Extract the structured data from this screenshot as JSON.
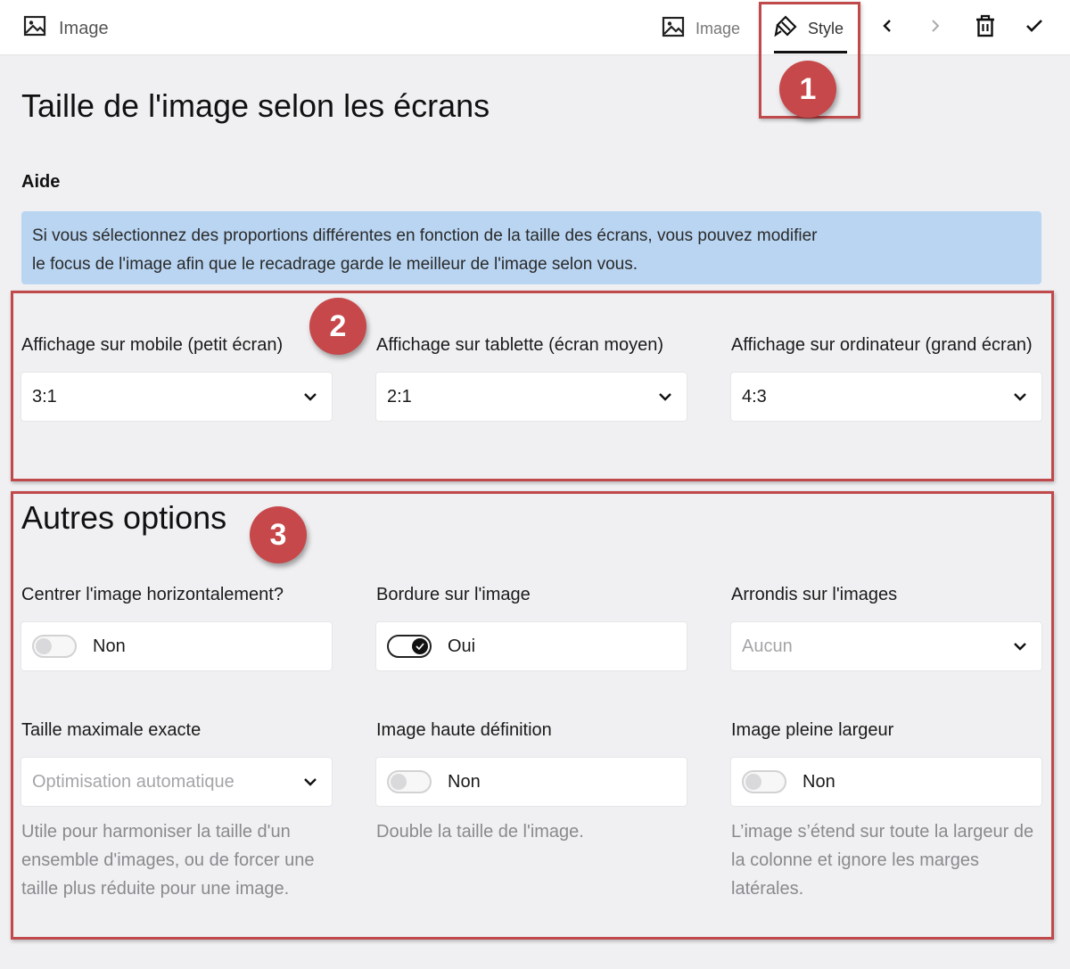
{
  "topbar": {
    "title": "Image",
    "tabs": [
      {
        "label": "Image",
        "icon": "image-icon"
      },
      {
        "label": "Style",
        "icon": "brush-icon",
        "active": true
      }
    ],
    "actions": [
      "chevron-left-icon",
      "chevron-right-icon",
      "trash-icon",
      "check-icon"
    ]
  },
  "page_title": "Taille de l'image selon les écrans",
  "help": {
    "label": "Aide",
    "line1": "Si vous sélectionnez des proportions différentes en fonction de la taille des écrans, vous pouvez modifier",
    "line2": "le focus de l'image afin que le recadrage garde le meilleur de l'image selon vous.",
    "bg_color": "#b9d5f2"
  },
  "ratios": {
    "mobile": {
      "label": "Affichage sur mobile (petit écran)",
      "value": "3:1"
    },
    "tablet": {
      "label": "Affichage sur tablette (écran moyen)",
      "value": "2:1"
    },
    "desktop": {
      "label": "Affichage sur ordinateur (grand écran)",
      "value": "4:3"
    }
  },
  "other": {
    "title": "Autres options",
    "center": {
      "label": "Centrer l'image horizontalement?",
      "value": "Non",
      "on": false
    },
    "border": {
      "label": "Bordure sur l'image",
      "value": "Oui",
      "on": true
    },
    "radius": {
      "label": "Arrondis sur l'images",
      "placeholder": "Aucun"
    },
    "max_size": {
      "label": "Taille maximale exacte",
      "placeholder": "Optimisation automatique",
      "hint": "Utile pour harmoniser la taille d'un ensemble d'images, ou de forcer une taille plus réduite pour une image."
    },
    "hd": {
      "label": "Image haute définition",
      "value": "Non",
      "on": false,
      "hint": "Double la taille de l'image."
    },
    "full_width": {
      "label": "Image pleine largeur",
      "value": "Non",
      "on": false,
      "hint": "L’image s’étend sur toute la largeur de la colonne et ignore les marges latérales."
    }
  },
  "annotations": {
    "badge1": "1",
    "badge2": "2",
    "badge3": "3",
    "color": "#c0494b"
  }
}
